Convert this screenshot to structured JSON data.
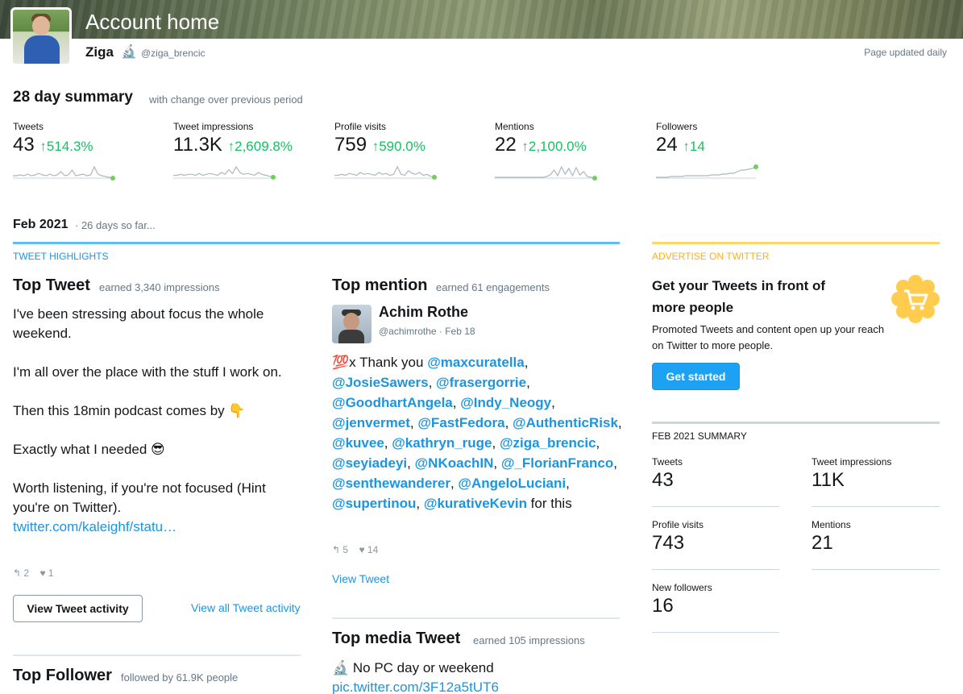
{
  "header": {
    "title": "Account home",
    "name": "Ziga",
    "name_emoji": "🔬",
    "handle": "@ziga_brencic",
    "updated": "Page updated daily"
  },
  "summary": {
    "title": "28 day summary",
    "subtitle": "with change over previous period",
    "stats": [
      {
        "label": "Tweets",
        "value": "43",
        "arrow": "↑",
        "change": "514.3%",
        "spark": [
          3,
          3,
          4,
          3,
          5,
          3,
          4,
          6,
          4,
          3,
          5,
          3,
          4,
          8,
          3,
          4,
          10,
          3,
          4,
          5,
          3,
          4,
          14,
          5,
          3,
          2,
          1,
          0
        ]
      },
      {
        "label": "Tweet impressions",
        "value": "11.3K",
        "arrow": "↑",
        "change": "2,609.8%",
        "spark": [
          3,
          3,
          4,
          3,
          4,
          4,
          3,
          5,
          3,
          4,
          5,
          4,
          3,
          6,
          4,
          9,
          5,
          12,
          6,
          4,
          5,
          4,
          3,
          6,
          4,
          3,
          2,
          1
        ]
      },
      {
        "label": "Profile visits",
        "value": "759",
        "arrow": "↑",
        "change": "590.0%",
        "spark": [
          3,
          3,
          4,
          3,
          5,
          4,
          3,
          6,
          4,
          5,
          4,
          3,
          6,
          4,
          5,
          3,
          4,
          12,
          4,
          3,
          8,
          5,
          4,
          6,
          3,
          4,
          2,
          1
        ]
      },
      {
        "label": "Mentions",
        "value": "22",
        "arrow": "↑",
        "change": "2,100.0%",
        "spark": [
          1,
          1,
          1,
          1,
          1,
          1,
          1,
          1,
          1,
          1,
          1,
          1,
          1,
          1,
          2,
          4,
          10,
          3,
          14,
          5,
          12,
          3,
          13,
          4,
          8,
          2,
          1,
          0
        ]
      },
      {
        "label": "Followers",
        "value": "24",
        "arrow": "↑",
        "change": "14",
        "spark": [
          1,
          1,
          1,
          1,
          2,
          2,
          2,
          2,
          3,
          3,
          3,
          3,
          3,
          3,
          3,
          4,
          4,
          4,
          5,
          5,
          6,
          6,
          8,
          10,
          10,
          11,
          12,
          14
        ]
      }
    ]
  },
  "month": {
    "title": "Feb 2021",
    "subtitle": "· 26 days so far..."
  },
  "highlights": {
    "label": "TWEET HIGHLIGHTS",
    "top_tweet": {
      "title": "Top Tweet",
      "subtitle": "earned 3,340 impressions",
      "paragraphs": [
        "I've been stressing about focus the whole weekend.",
        "I'm all over the place with the stuff I work on.",
        "Then this 18min podcast comes by 👇",
        "Exactly what I needed 😎",
        "Worth listening, if you're not focused (Hint you're on Twitter)."
      ],
      "link": "twitter.com/kaleighf/statu…",
      "retweets": "2",
      "likes": "1",
      "btn": "View Tweet activity",
      "view_all": "View all Tweet activity"
    },
    "top_mention": {
      "title": "Top mention",
      "subtitle": "earned 61 engagements",
      "name": "Achim Rothe",
      "handle": "@achimrothe · Feb 18",
      "prefix": "💯x Thank you ",
      "mentions": [
        "@maxcuratella",
        "@JosieSawers",
        "@frasergorrie",
        "@GoodhartAngela",
        "@Indy_Neogy",
        "@jenvermet",
        "@FastFedora",
        "@AuthenticRisk",
        "@kuvee",
        "@kathryn_ruge",
        "@ziga_brencic",
        "@seyiadeyi",
        "@NKoachIN",
        "@_FlorianFranco",
        "@senthewanderer",
        "@AngeloLuciani",
        "@supertinou",
        "@kurativeKevin"
      ],
      "suffix": " for this",
      "retweets": "5",
      "likes": "14",
      "view_tweet": "View Tweet"
    },
    "top_follower": {
      "title": "Top Follower",
      "subtitle": "followed by 61.9K people"
    },
    "top_media": {
      "title": "Top media Tweet",
      "subtitle": "earned 105 impressions",
      "text": "🔬 No PC day or weekend",
      "link": "pic.twitter.com/3F12a5tUT6"
    }
  },
  "advertise": {
    "label": "ADVERTISE ON TWITTER",
    "title": "Get your Tweets in front of more people",
    "body": "Promoted Tweets and content open up your reach on Twitter to more people.",
    "btn": "Get started",
    "badge_color": "#ffcc4d"
  },
  "feb_summary": {
    "label": "FEB 2021 SUMMARY",
    "cells": [
      {
        "label": "Tweets",
        "value": "43"
      },
      {
        "label": "Tweet impressions",
        "value": "11K"
      },
      {
        "label": "Profile visits",
        "value": "743"
      },
      {
        "label": "Mentions",
        "value": "21"
      },
      {
        "label": "New followers",
        "value": "16"
      }
    ]
  }
}
